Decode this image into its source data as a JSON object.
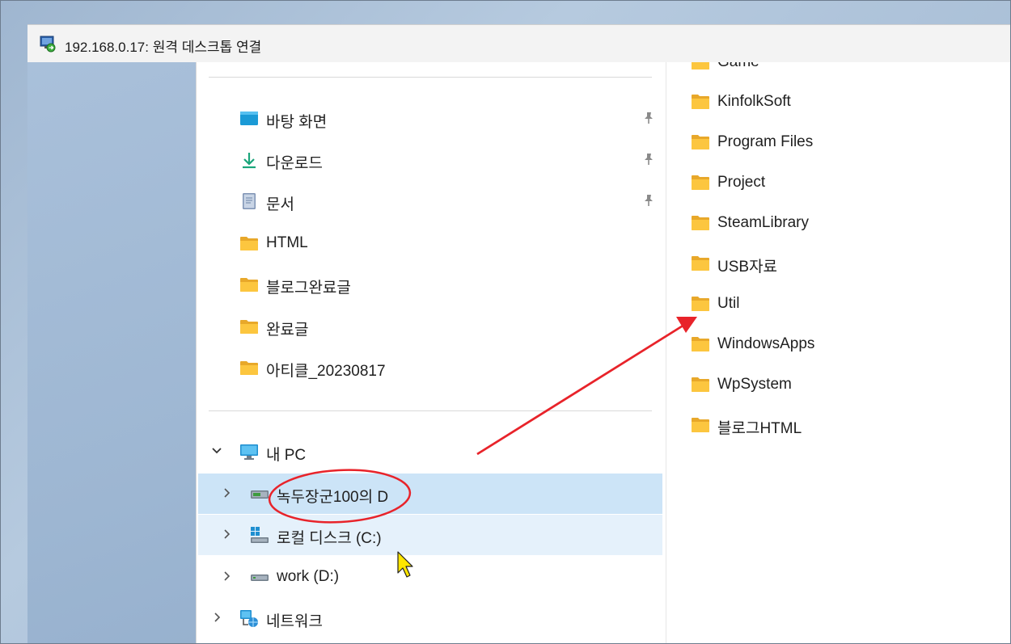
{
  "window": {
    "title": "192.168.0.17: 원격 데스크톱 연결"
  },
  "quick_access": [
    {
      "label": "바탕 화면",
      "icon": "desktop-icon",
      "pinned": true
    },
    {
      "label": "다운로드",
      "icon": "download-icon",
      "pinned": true
    },
    {
      "label": "문서",
      "icon": "document-icon",
      "pinned": true
    },
    {
      "label": "HTML",
      "icon": "folder-icon",
      "pinned": false
    },
    {
      "label": "블로그완료글",
      "icon": "folder-icon",
      "pinned": false
    },
    {
      "label": "완료글",
      "icon": "folder-icon",
      "pinned": false
    },
    {
      "label": "아티클_20230817",
      "icon": "folder-icon",
      "pinned": false
    }
  ],
  "this_pc": {
    "label": "내 PC",
    "expanded": true,
    "drives": [
      {
        "label": "녹두장군100의 D",
        "icon": "network-drive-icon",
        "state": "selected"
      },
      {
        "label": "로컬 디스크 (C:)",
        "icon": "windows-drive-icon",
        "state": "hover"
      },
      {
        "label": "work (D:)",
        "icon": "drive-icon",
        "state": "normal"
      }
    ]
  },
  "network": {
    "label": "네트워크"
  },
  "content_folders": [
    "Game",
    "KinfolkSoft",
    "Program Files",
    "Project",
    "SteamLibrary",
    "USB자료",
    "Util",
    "WindowsApps",
    "WpSystem",
    "블로그HTML"
  ],
  "annotation": {
    "color": "#e8232a"
  }
}
